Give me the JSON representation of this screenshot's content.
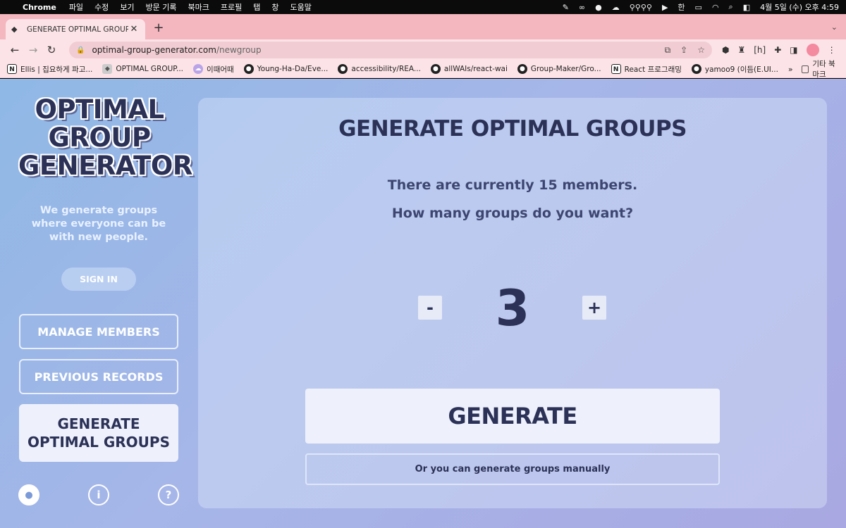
{
  "menubar": {
    "app": "Chrome",
    "menus": [
      "파일",
      "수정",
      "보기",
      "방문 기록",
      "북마크",
      "프로필",
      "탭",
      "창",
      "도움말"
    ],
    "datetime": "4월 5일 (수) 오후 4:59",
    "input_source": "한"
  },
  "browser": {
    "tab_title": "GENERATE OPTIMAL GROUPS",
    "url_host": "optimal-group-generator.com",
    "url_path": "/newgroup",
    "bookmarks": [
      {
        "label": "Ellis | 집요하게 파고...",
        "icon": "notion-icon"
      },
      {
        "label": "OPTIMAL GROUP...",
        "icon": "cube-icon"
      },
      {
        "label": "이때어때",
        "icon": "cloud-icon"
      },
      {
        "label": "Young-Ha-Da/Eve...",
        "icon": "github-icon"
      },
      {
        "label": "accessibility/REA...",
        "icon": "github-icon"
      },
      {
        "label": "allWAIs/react-wai",
        "icon": "github-icon"
      },
      {
        "label": "Group-Maker/Gro...",
        "icon": "github-icon"
      },
      {
        "label": "React 프로그래밍",
        "icon": "notion-icon"
      },
      {
        "label": "yamoo9 (이듬(E.UI...",
        "icon": "github-icon"
      }
    ],
    "bookmarks_more": "»",
    "other_bookmarks": "기타 북마크"
  },
  "sidebar": {
    "logo_lines": [
      "OPTIMAL",
      "GROUP",
      "GENERATOR"
    ],
    "tagline": "We generate groups where everyone can be with new people.",
    "sign_in": "SIGN IN",
    "nav": {
      "manage": "MANAGE MEMBERS",
      "previous": "PREVIOUS RECORDS",
      "generate_line1": "GENERATE",
      "generate_line2": "OPTIMAL GROUPS"
    }
  },
  "main": {
    "title": "GENERATE OPTIMAL GROUPS",
    "member_info": "There are currently 15 members.",
    "question": "How many groups do you want?",
    "decrement": "-",
    "increment": "+",
    "group_count": "3",
    "generate_button": "GENERATE",
    "manual_link": "Or you can generate groups manually"
  }
}
